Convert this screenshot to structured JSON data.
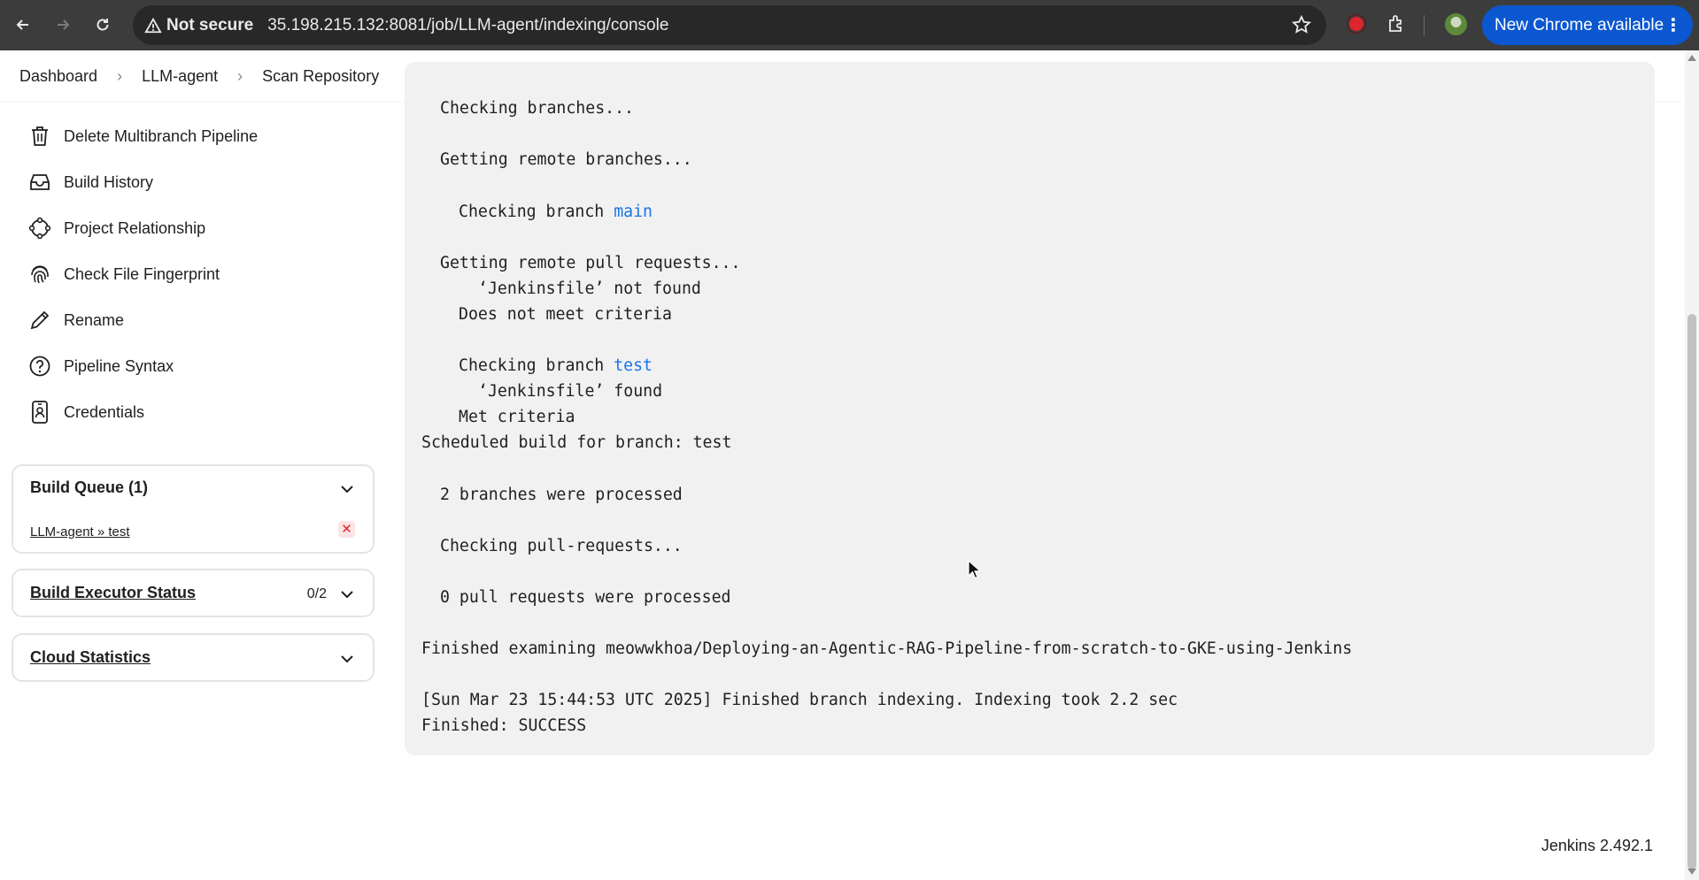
{
  "browser": {
    "security_label": "Not secure",
    "url": "35.198.215.132:8081/job/LLM-agent/indexing/console",
    "update_button_label": "New Chrome available",
    "colors": {
      "toolbar": "#3c3c3c",
      "omnibox": "#282828",
      "update_button": "#0b57d0",
      "record_dot": "#e0242c"
    }
  },
  "breadcrumb": {
    "items": [
      "Dashboard",
      "LLM-agent",
      "Scan Repository"
    ],
    "separator": "›"
  },
  "sidebar": {
    "items": [
      {
        "label": "Delete Multibranch Pipeline",
        "icon": "trash-icon"
      },
      {
        "label": "Build History",
        "icon": "inbox-icon"
      },
      {
        "label": "Project Relationship",
        "icon": "relationship-icon"
      },
      {
        "label": "Check File Fingerprint",
        "icon": "fingerprint-icon"
      },
      {
        "label": "Rename",
        "icon": "pencil-icon"
      },
      {
        "label": "Pipeline Syntax",
        "icon": "help-circle-icon"
      },
      {
        "label": "Credentials",
        "icon": "credentials-icon"
      }
    ]
  },
  "build_queue": {
    "title": "Build Queue (1)",
    "items": [
      {
        "label": "LLM-agent » test",
        "cancel": "✕"
      }
    ]
  },
  "executor_status": {
    "title": "Build Executor Status",
    "count": "0/2"
  },
  "cloud_statistics": {
    "title": "Cloud Statistics"
  },
  "console": {
    "lines": [
      {
        "text": "Checking branches...",
        "indent": 1
      },
      {
        "text": "Getting remote branches...",
        "indent": 1
      },
      {
        "text": "Checking branch ",
        "link": "main",
        "indent": 2
      },
      {
        "text": "Getting remote pull requests...",
        "indent": 1
      },
      {
        "text": "‘Jenkinsfile’ not found",
        "indent": 3
      },
      {
        "text": "Does not meet criteria",
        "indent": 2
      },
      {
        "text": "Checking branch ",
        "link": "test",
        "indent": 2
      },
      {
        "text": "‘Jenkinsfile’ found",
        "indent": 3
      },
      {
        "text": "Met criteria",
        "indent": 2
      },
      {
        "text": "Scheduled build for branch: test",
        "indent": 0
      },
      {
        "text": "2 branches were processed",
        "indent": 1
      },
      {
        "text": "Checking pull-requests...",
        "indent": 1
      },
      {
        "text": "0 pull requests were processed",
        "indent": 1
      },
      {
        "text": "Finished examining meowwkhoa/Deploying-an-Agentic-RAG-Pipeline-from-scratch-to-GKE-using-Jenkins",
        "indent": 0
      },
      {
        "text": "[Sun Mar 23 15:44:53 UTC 2025] Finished branch indexing. Indexing took 2.2 sec",
        "indent": 0
      },
      {
        "text": "Finished: SUCCESS",
        "indent": 0
      }
    ],
    "link_color": "#1a73e8"
  },
  "footer": {
    "version": "Jenkins 2.492.1"
  }
}
